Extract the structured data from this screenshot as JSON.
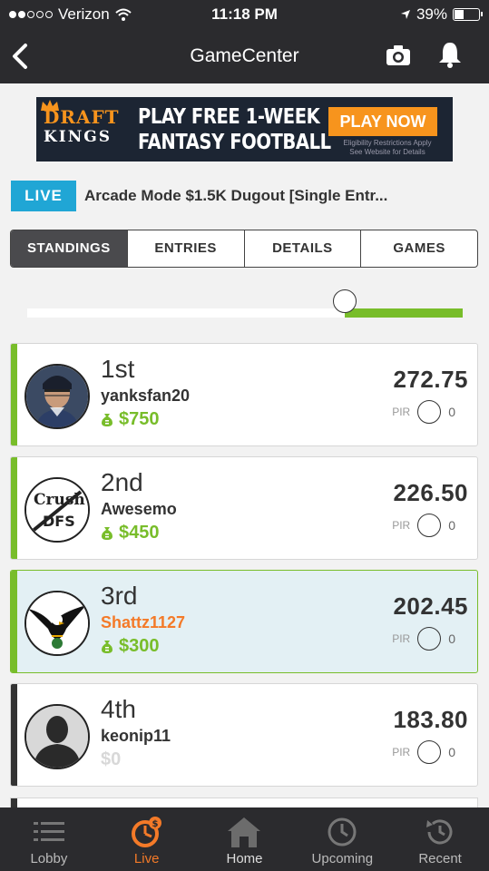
{
  "status_bar": {
    "carrier": "Verizon",
    "time": "11:18 PM",
    "battery": "39%",
    "battery_level": 0.39
  },
  "nav": {
    "title": "GameCenter",
    "icons": [
      "back-chevron-icon",
      "camera-icon",
      "bell-icon"
    ]
  },
  "ad": {
    "brand_line1": "DRAFT",
    "brand_line2": "KINGS",
    "headline_line1": "PLAY FREE 1-WEEK",
    "headline_line2": "FANTASY FOOTBALL",
    "cta": "PLAY NOW",
    "fine_print_1": "Eligibility Restrictions Apply",
    "fine_print_2": "See Website for Details"
  },
  "contest": {
    "badge": "LIVE",
    "title": "Arcade Mode $1.5K Dugout [Single Entr..."
  },
  "tabs": [
    {
      "label": "STANDINGS",
      "active": true
    },
    {
      "label": "ENTRIES",
      "active": false
    },
    {
      "label": "DETAILS",
      "active": false
    },
    {
      "label": "GAMES",
      "active": false
    }
  ],
  "progress": {
    "fraction": 0.73
  },
  "standings": [
    {
      "rank": "1st",
      "user": "yanksfan20",
      "prize": "$750",
      "score": "272.75",
      "pir_label": "PIR",
      "pir": "0",
      "avatar": "catcher-photo-avatar"
    },
    {
      "rank": "2nd",
      "user": "Awesemo",
      "prize": "$450",
      "score": "226.50",
      "pir_label": "PIR",
      "pir": "0",
      "avatar": "crush-dfs-logo-avatar"
    },
    {
      "rank": "3rd",
      "user": "Shattz1127",
      "prize": "$300",
      "score": "202.45",
      "pir_label": "PIR",
      "pir": "0",
      "avatar": "eagle-avatar"
    },
    {
      "rank": "4th",
      "user": "keonip11",
      "prize": "$0",
      "score": "183.80",
      "pir_label": "PIR",
      "pir": "0",
      "avatar": "default-silhouette-avatar"
    }
  ],
  "tabbar": [
    {
      "label": "Lobby",
      "icon": "list-icon",
      "active": false
    },
    {
      "label": "Live",
      "icon": "live-stopwatch-icon",
      "active": true
    },
    {
      "label": "Home",
      "icon": "home-icon",
      "active": false
    },
    {
      "label": "Upcoming",
      "icon": "clock-icon",
      "active": false
    },
    {
      "label": "Recent",
      "icon": "history-icon",
      "active": false
    }
  ],
  "colors": {
    "accent_green": "#78bd2a",
    "live_blue": "#20a6d5",
    "orange": "#f47a28",
    "dark_bar": "#2b2b2e"
  }
}
